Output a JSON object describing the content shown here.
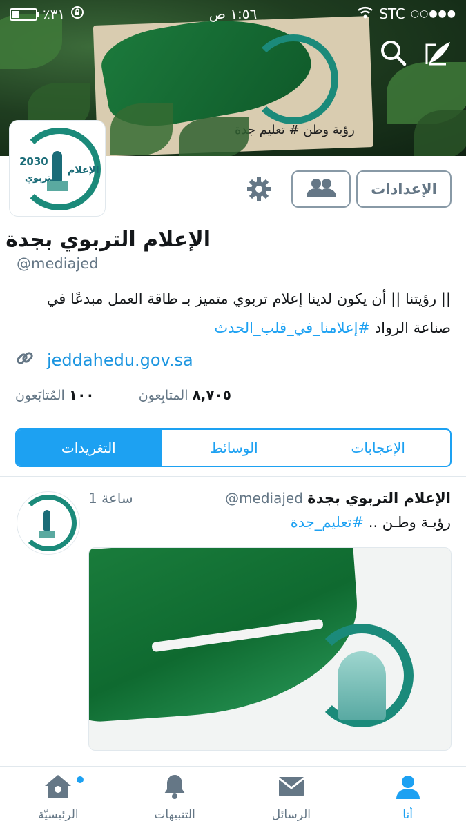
{
  "status_bar": {
    "carrier": "STC",
    "signal": "○○●●●",
    "time": "١:٥٦ ص",
    "battery_percent": "٪٣١",
    "battery_level": 0.31
  },
  "banner": {
    "caption": "رؤية وطن # تعليم جدة"
  },
  "profile": {
    "settings_button": "الإعدادات",
    "name": "الإعلام التربوي بجدة",
    "handle": "@mediajed",
    "bio_line1": "|| رؤيتنا || أن يكون لدينا إعلام تربوي متميز بـ طاقة العمل مبدعًا في",
    "bio_line2_text": "صناعة الرواد",
    "bio_line2_tag": "#إعلامنا_في_قلب_الحدث",
    "website": "jeddahedu.gov.sa",
    "followers_count": "٨,٧٠٥",
    "followers_label": "المتابِعون",
    "following_count": "١٠٠",
    "following_label": "المُتابَعون"
  },
  "tabs": [
    {
      "label": "الإعجابات"
    },
    {
      "label": "الوسائط"
    },
    {
      "label": "التغريدات"
    }
  ],
  "tweet": {
    "name": "الإعلام التربوي بجدة",
    "handle": "@mediajed",
    "time": "1 ساعة",
    "text": "رؤيـة وطـن ..",
    "tag": "#تعليم_جدة"
  },
  "avatar_logo": {
    "year": "2030",
    "title": "الإعلام",
    "subtitle": "التربوي"
  },
  "nav": [
    {
      "label": "الرئيسيّة",
      "icon": "home-icon"
    },
    {
      "label": "التنبيهات",
      "icon": "bell-icon"
    },
    {
      "label": "الرسائل",
      "icon": "envelope-icon"
    },
    {
      "label": "أنا",
      "icon": "person-icon"
    }
  ],
  "colors": {
    "accent": "#1da1f2",
    "muted": "#657786",
    "brand_teal": "#1b8a7a"
  }
}
